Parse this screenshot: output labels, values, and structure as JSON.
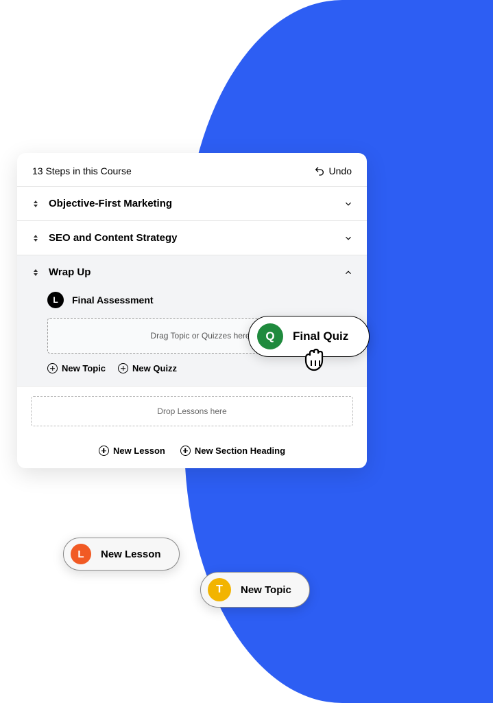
{
  "header": {
    "steps": "13 Steps in this Course",
    "undo": "Undo"
  },
  "sections": [
    {
      "title": "Objective-First Marketing"
    },
    {
      "title": "SEO and Content Strategy"
    },
    {
      "title": "Wrap Up"
    }
  ],
  "lesson": {
    "badge": "L",
    "title": "Final Assessment"
  },
  "dropzone": "Drag Topic or Quizzes here",
  "actions": {
    "newTopic": "New Topic",
    "newQuizz": "New Quizz"
  },
  "dropLessons": "Drop Lessons here",
  "footer": {
    "newLesson": "New Lesson",
    "newSectionHeading": "New Section Heading"
  },
  "pills": {
    "quiz": {
      "badge": "Q",
      "label": "Final Quiz"
    },
    "lesson": {
      "badge": "L",
      "label": "New Lesson"
    },
    "topic": {
      "badge": "T",
      "label": "New Topic"
    }
  }
}
